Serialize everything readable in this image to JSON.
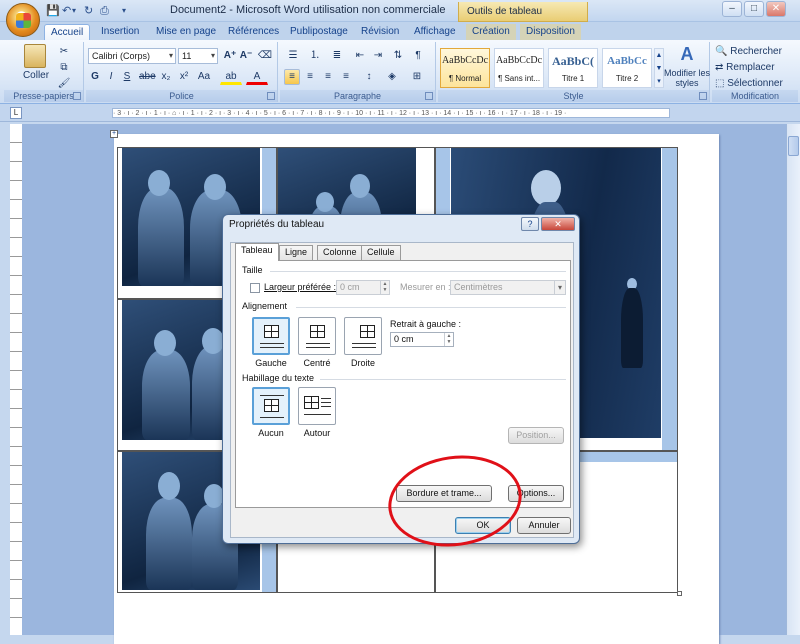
{
  "window": {
    "title": "Document2 - Microsoft Word utilisation non commerciale",
    "context_tab_title": "Outils de tableau",
    "controls": {
      "minimize": "–",
      "maximize": "□",
      "close": "✕"
    }
  },
  "tabs": [
    "Accueil",
    "Insertion",
    "Mise en page",
    "Références",
    "Publipostage",
    "Révision",
    "Affichage",
    "Création",
    "Disposition"
  ],
  "ribbon": {
    "clipboard": {
      "paste_label": "Coller",
      "group_label": "Presse-papiers"
    },
    "font": {
      "font_name": "Calibri (Corps)",
      "font_size": "11",
      "group_label": "Police"
    },
    "paragraph": {
      "group_label": "Paragraphe"
    },
    "styles": {
      "group_label": "Style",
      "items": [
        {
          "sample": "AaBbCcDc",
          "name": "¶ Normal"
        },
        {
          "sample": "AaBbCcDc",
          "name": "¶ Sans int..."
        },
        {
          "sample": "AaBbC(",
          "name": "Titre 1"
        },
        {
          "sample": "AaBbCc",
          "name": "Titre 2"
        }
      ],
      "change_styles_label": "Modifier les styles"
    },
    "editing": {
      "group_label": "Modification",
      "find": "Rechercher",
      "replace": "Remplacer",
      "select": "Sélectionner"
    }
  },
  "ruler_text": "· 3 · ı · 2 · ı · 1 · ı · ⌂ · ı · 1 · ı · 2 · ı · 3 · ı · 4 · ı · 5 · ı · 6 · ı · 7 · ı · 8 · ı · 9 · ı · 10 · ı · 11 · ı · 12 · ı · 13 · ı · 14 · ı · 15 · ı · 16 · ı · 17 · ı · 18 · ı · 19 ·",
  "dialog": {
    "title": "Propriétés du tableau",
    "help": "?",
    "close": "✕",
    "tabs": [
      "Tableau",
      "Ligne",
      "Colonne",
      "Cellule"
    ],
    "size": {
      "section": "Taille",
      "preferred_width_label": "Largeur préférée :",
      "preferred_width_value": "0 cm",
      "measure_label": "Mesurer en :",
      "measure_value": "Centimètres"
    },
    "alignment": {
      "section": "Alignement",
      "options": [
        "Gauche",
        "Centré",
        "Droite"
      ],
      "selected": "Gauche",
      "indent_label": "Retrait à gauche :",
      "indent_value": "0 cm"
    },
    "wrapping": {
      "section": "Habillage du texte",
      "options": [
        "Aucun",
        "Autour"
      ],
      "selected": "Aucun",
      "position_button": "Position..."
    },
    "borders_button": "Bordure et trame...",
    "options_button": "Options...",
    "ok_button": "OK",
    "cancel_button": "Annuler"
  },
  "colors": {
    "ribbon_text": "#15428b",
    "highlight_circle": "#e01018",
    "selected_option": "#5aa0d8"
  }
}
